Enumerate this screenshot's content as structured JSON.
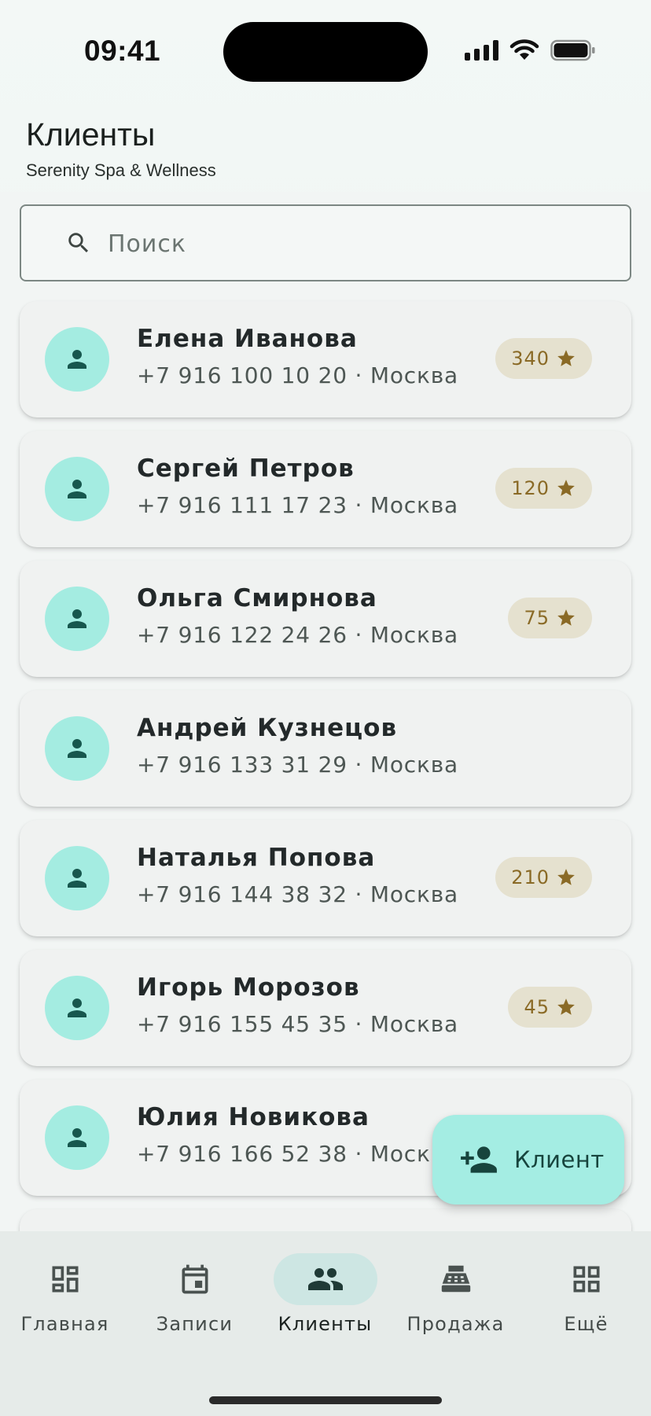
{
  "status_bar": {
    "time": "09:41"
  },
  "header": {
    "title": "Клиенты",
    "subtitle": "Serenity Spa & Wellness"
  },
  "search": {
    "placeholder": "Поиск",
    "value": ""
  },
  "clients": [
    {
      "name": "Елена Иванова",
      "meta": "+7 916 100 10 20 · Москва",
      "points": "340"
    },
    {
      "name": "Сергей Петров",
      "meta": "+7 916 111 17 23 · Москва",
      "points": "120"
    },
    {
      "name": "Ольга Смирнова",
      "meta": "+7 916 122 24 26 · Москва",
      "points": "75"
    },
    {
      "name": "Андрей Кузнецов",
      "meta": "+7 916 133 31 29 · Москва",
      "points": null
    },
    {
      "name": "Наталья Попова",
      "meta": "+7 916 144 38 32 · Москва",
      "points": "210"
    },
    {
      "name": "Игорь Морозов",
      "meta": "+7 916 155 45 35 · Москва",
      "points": "45"
    },
    {
      "name": "Юлия Новикова",
      "meta": "+7 916 166 52 38 · Москва",
      "points": null
    }
  ],
  "fab": {
    "label": "Клиент",
    "icon": "add-person-icon"
  },
  "nav": {
    "items": [
      {
        "label": "Главная",
        "icon": "dashboard-icon"
      },
      {
        "label": "Записи",
        "icon": "calendar-icon"
      },
      {
        "label": "Клиенты",
        "icon": "people-icon",
        "active": true
      },
      {
        "label": "Продажа",
        "icon": "cash-register-icon"
      },
      {
        "label": "Ещё",
        "icon": "apps-grid-icon"
      }
    ]
  },
  "colors": {
    "accent": "#a4ece1",
    "avatar_icon": "#17574e",
    "badge_bg": "#e5e1cf",
    "badge_text": "#8a6a26",
    "nav_active": "#cde6e3"
  }
}
